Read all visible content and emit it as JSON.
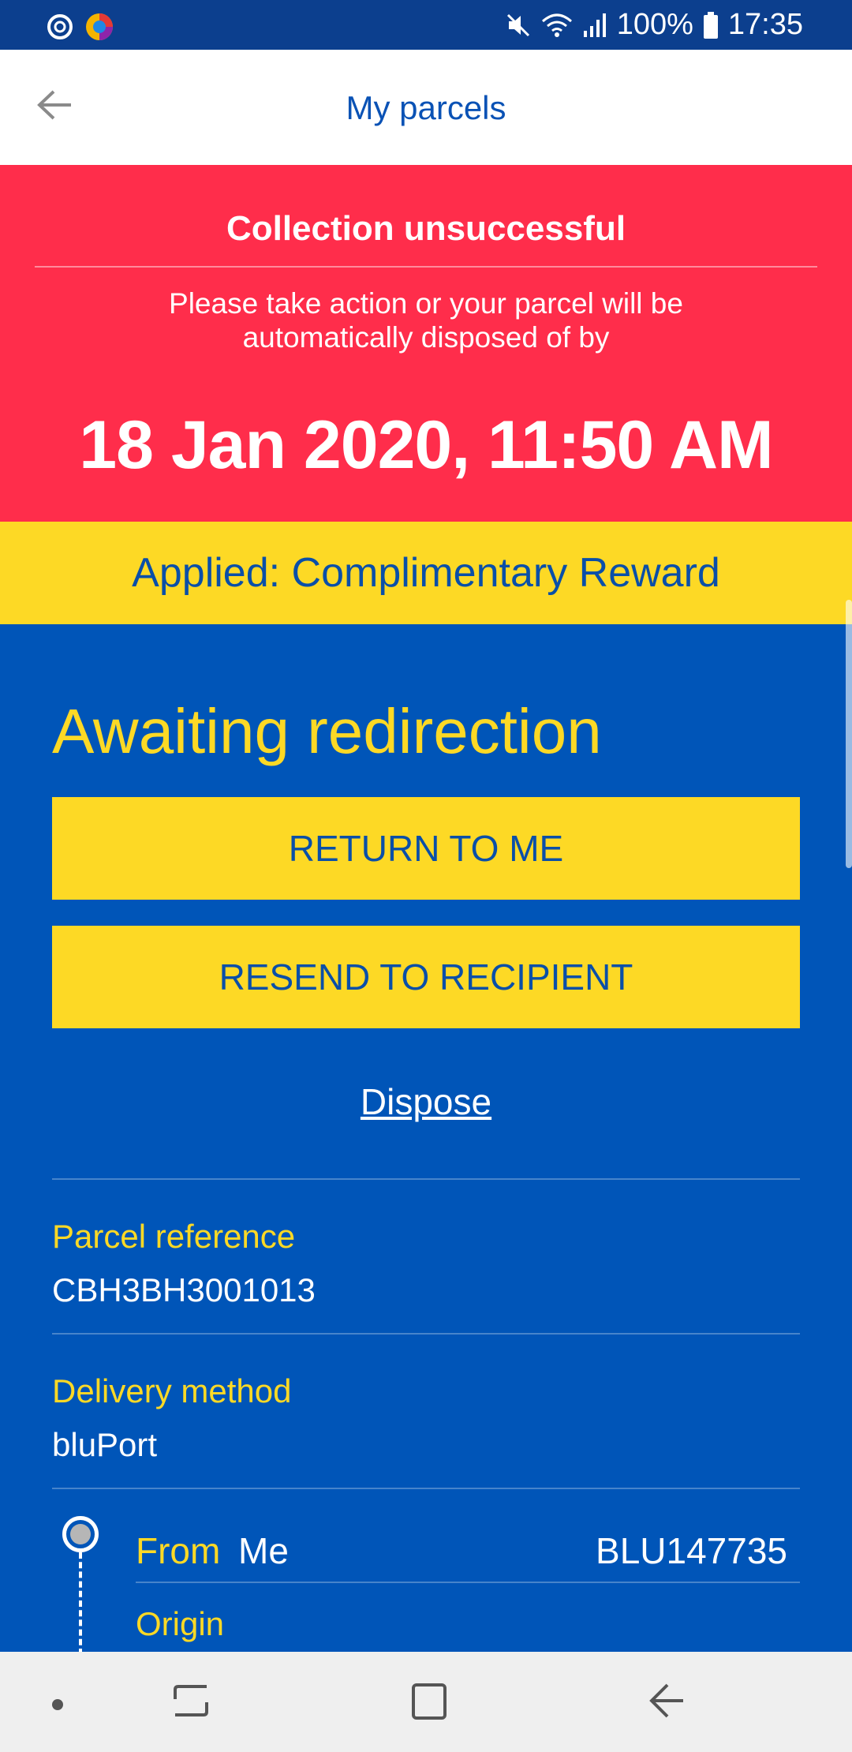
{
  "status_bar": {
    "battery": "100%",
    "time": "17:35"
  },
  "header": {
    "title": "My parcels"
  },
  "alert": {
    "title": "Collection unsuccessful",
    "message": "Please take action or your parcel will be automatically disposed of by",
    "deadline": "18 Jan 2020, 11:50 AM"
  },
  "reward": {
    "text": "Applied: Complimentary Reward"
  },
  "main": {
    "status": "Awaiting redirection",
    "return_label": "RETURN TO ME",
    "resend_label": "RESEND TO RECIPIENT",
    "dispose_label": "Dispose",
    "parcel_reference_label": "Parcel reference",
    "parcel_reference": "CBH3BH3001013",
    "delivery_method_label": "Delivery method",
    "delivery_method": "bluPort",
    "from_label": "From",
    "from_value": "Me",
    "from_code": "BLU147735",
    "origin_label": "Origin"
  },
  "colors": {
    "alert_red": "#ff2d4b",
    "brand_blue": "#0055b8",
    "accent_yellow": "#fdd925"
  },
  "icons": [
    "back-arrow-icon",
    "mute-icon",
    "wifi-icon",
    "signal-icon",
    "battery-icon",
    "nav-recent-icon",
    "nav-home-icon",
    "nav-back-icon"
  ]
}
